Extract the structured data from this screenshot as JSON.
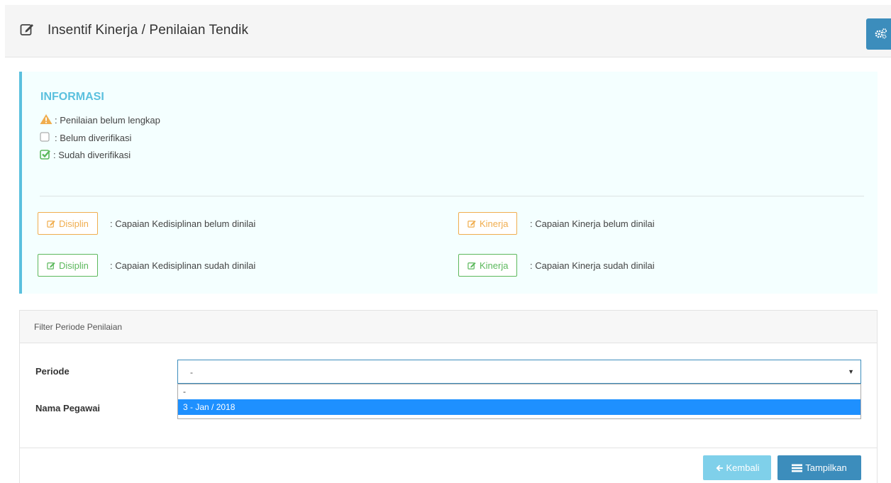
{
  "header": {
    "title": "Insentif Kinerja / Penilaian Tendik",
    "title_icon": "edit-icon",
    "settings_icon": "gears-icon"
  },
  "info": {
    "title": "INFORMASI",
    "legend": [
      {
        "icon": "warning-icon",
        "text": ": Penilaian belum lengkap"
      },
      {
        "icon": "unchecked-box-icon",
        "text": ": Belum diverifikasi"
      },
      {
        "icon": "checked-box-icon",
        "text": ": Sudah diverifikasi"
      }
    ],
    "buttons": {
      "disiplin_orange": {
        "label": "Disiplin",
        "desc": ": Capaian Kedisiplinan belum dinilai"
      },
      "kinerja_orange": {
        "label": "Kinerja",
        "desc": ": Capaian Kinerja belum dinilai"
      },
      "disiplin_green": {
        "label": "Disiplin",
        "desc": ": Capaian Kedisiplinan sudah dinilai"
      },
      "kinerja_green": {
        "label": "Kinerja",
        "desc": ": Capaian Kinerja sudah dinilai"
      }
    },
    "colors": {
      "accent": "#5bc0de",
      "orange": "#f0ad4e",
      "green": "#5cb85c"
    }
  },
  "filter": {
    "heading": "Filter Periode Penilaian",
    "periode_label": "Periode",
    "periode_value": "-",
    "options": [
      "-",
      "3 - Jan / 2018"
    ],
    "nama_label": "Nama Pegawai"
  },
  "actions": {
    "back_label": "Kembali",
    "show_label": "Tampilkan",
    "primary_color": "#3c8dbc"
  }
}
